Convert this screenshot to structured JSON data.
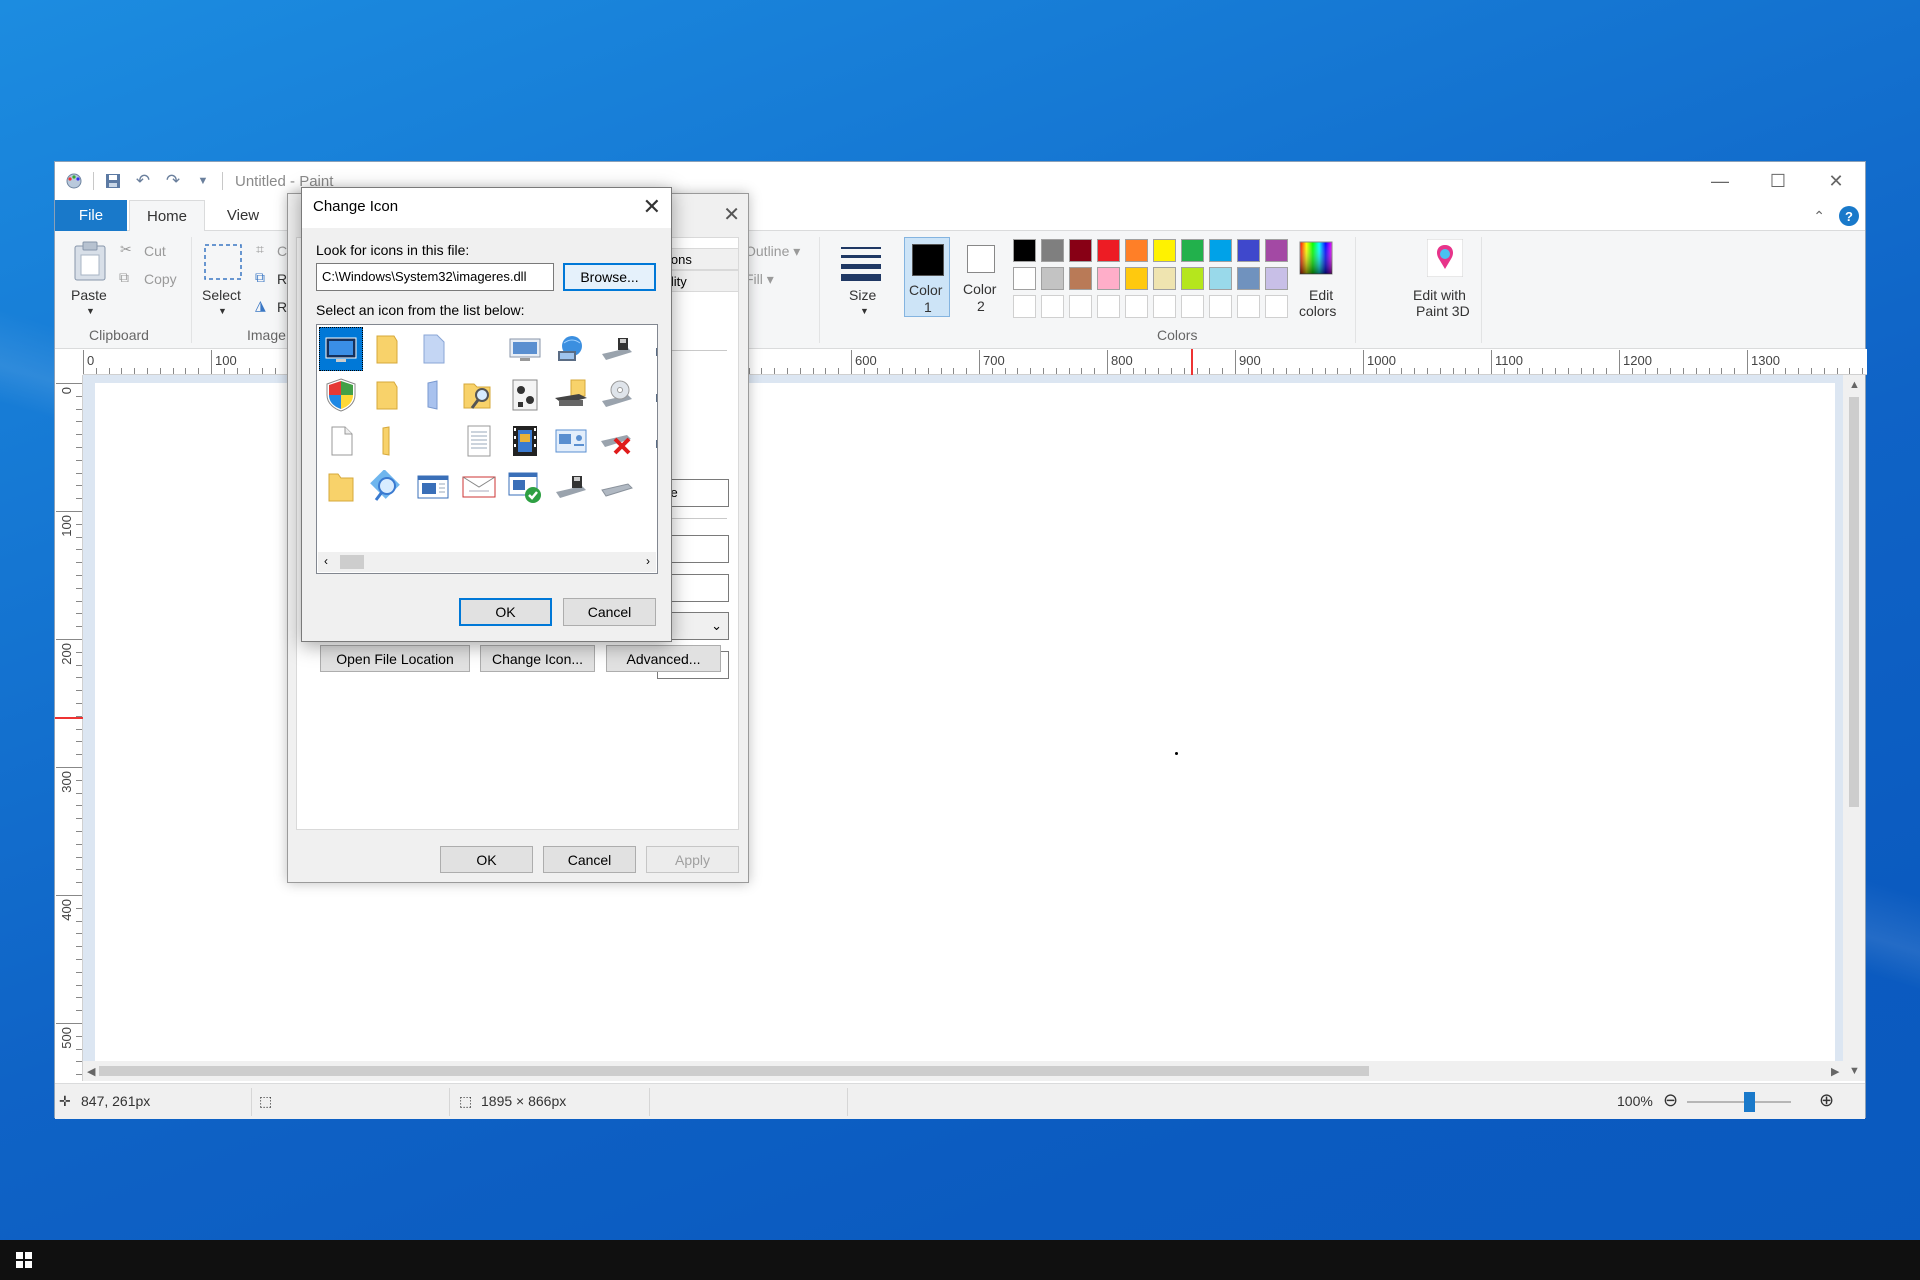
{
  "window": {
    "title": "Untitled - Paint"
  },
  "tabs": {
    "file": "File",
    "home": "Home",
    "view": "View"
  },
  "clipboard": {
    "paste": "Paste",
    "cut": "Cut",
    "copy": "Copy",
    "group_label": "Clipboard"
  },
  "image": {
    "select": "Select",
    "crop_partial": "Cr",
    "resize_partial": "R",
    "rotate_partial": "R",
    "group_label": "Image"
  },
  "shapes": {
    "outline": "Outline",
    "fill": "Fill"
  },
  "size": {
    "label": "Size"
  },
  "colors": {
    "color1": "Color\n1",
    "color1_line1": "Color",
    "color1_line2": "1",
    "color2_line1": "Color",
    "color2_line2": "2",
    "edit_colors_line1": "Edit",
    "edit_colors_line2": "colors",
    "paint3d_line1": "Edit with",
    "paint3d_line2": "Paint 3D",
    "group_label": "Colors",
    "color1_value": "#000000",
    "color2_value": "#ffffff",
    "palette_row1": [
      "#000000",
      "#7f7f7f",
      "#880015",
      "#ed1c24",
      "#ff7f27",
      "#fff200",
      "#22b14c",
      "#00a2e8",
      "#3f48cc",
      "#a349a4"
    ],
    "palette_row2": [
      "#ffffff",
      "#c3c3c3",
      "#b97a57",
      "#ffaec9",
      "#ffc90e",
      "#efe4b0",
      "#b5e61d",
      "#99d9ea",
      "#7092be",
      "#c8bfe7"
    ]
  },
  "ruler_h": [
    "0",
    "100",
    "600",
    "700",
    "800",
    "900",
    "1000",
    "1100",
    "1200",
    "1300"
  ],
  "ruler_v": [
    "0",
    "100",
    "200",
    "300",
    "400",
    "500"
  ],
  "status": {
    "cursor_pos": "847, 261px",
    "canvas_size": "1895 × 866px",
    "zoom": "100%"
  },
  "properties_dialog": {
    "tab_partial_1": "ions",
    "tab_partial_2": "ility",
    "field_partial": "xe",
    "open_file_location": "Open File Location",
    "change_icon": "Change Icon...",
    "advanced": "Advanced...",
    "ok": "OK",
    "cancel": "Cancel",
    "apply": "Apply"
  },
  "change_icon_dialog": {
    "title": "Change Icon",
    "look_label": "Look for icons in this file:",
    "path_value": "C:\\Windows\\System32\\imageres.dll",
    "browse": "Browse...",
    "select_label": "Select an icon from the list below:",
    "ok": "OK",
    "cancel": "Cancel"
  }
}
